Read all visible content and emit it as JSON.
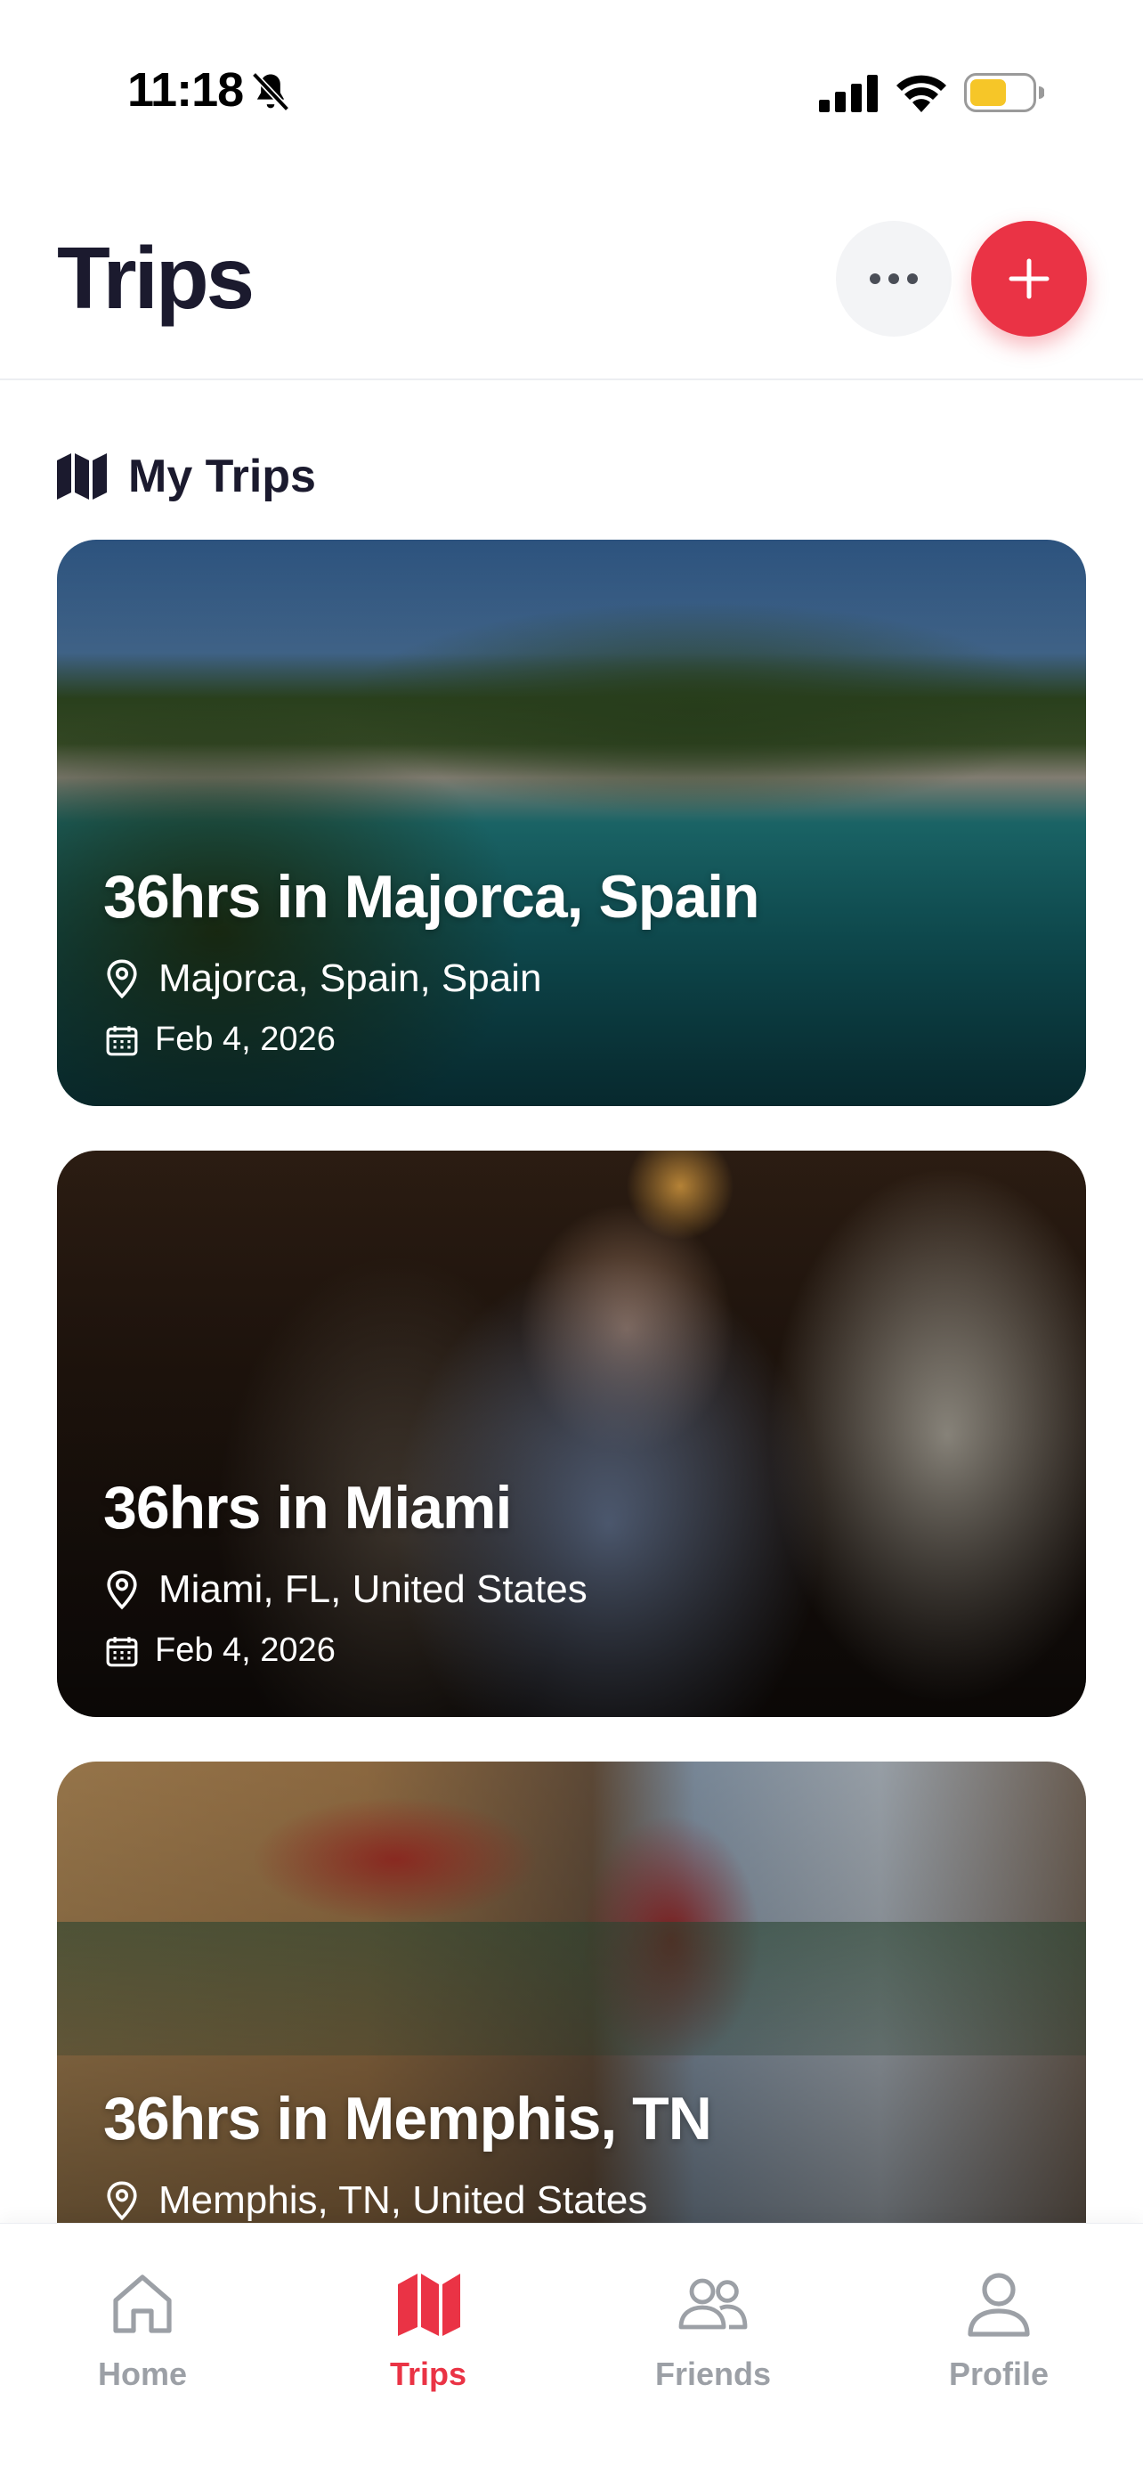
{
  "status_bar": {
    "time": "11:18",
    "icons": [
      "bell-slash-icon",
      "signal-icon",
      "wifi-icon",
      "battery-icon"
    ],
    "battery_color": "#f6c628"
  },
  "header": {
    "title": "Trips",
    "more_icon": "more-horizontal-icon",
    "add_icon": "plus-icon"
  },
  "section": {
    "icon": "map-icon",
    "title": "My Trips"
  },
  "trips": [
    {
      "title": "36hrs in Majorca, Spain",
      "location": "Majorca, Spain, Spain",
      "date": "Feb 4, 2026"
    },
    {
      "title": "36hrs in Miami",
      "location": "Miami, FL, United States",
      "date": "Feb 4, 2026"
    },
    {
      "title": "36hrs in Memphis, TN",
      "location": "Memphis, TN, United States",
      "date": ""
    }
  ],
  "tab_bar": {
    "items": [
      {
        "label": "Home",
        "icon": "home-icon",
        "active": false
      },
      {
        "label": "Trips",
        "icon": "map-icon",
        "active": true
      },
      {
        "label": "Friends",
        "icon": "friends-icon",
        "active": false
      },
      {
        "label": "Profile",
        "icon": "profile-icon",
        "active": false
      }
    ]
  },
  "colors": {
    "accent": "#ea3345",
    "text_dark": "#1b1a2e",
    "tab_inactive": "#9ca0a6"
  }
}
